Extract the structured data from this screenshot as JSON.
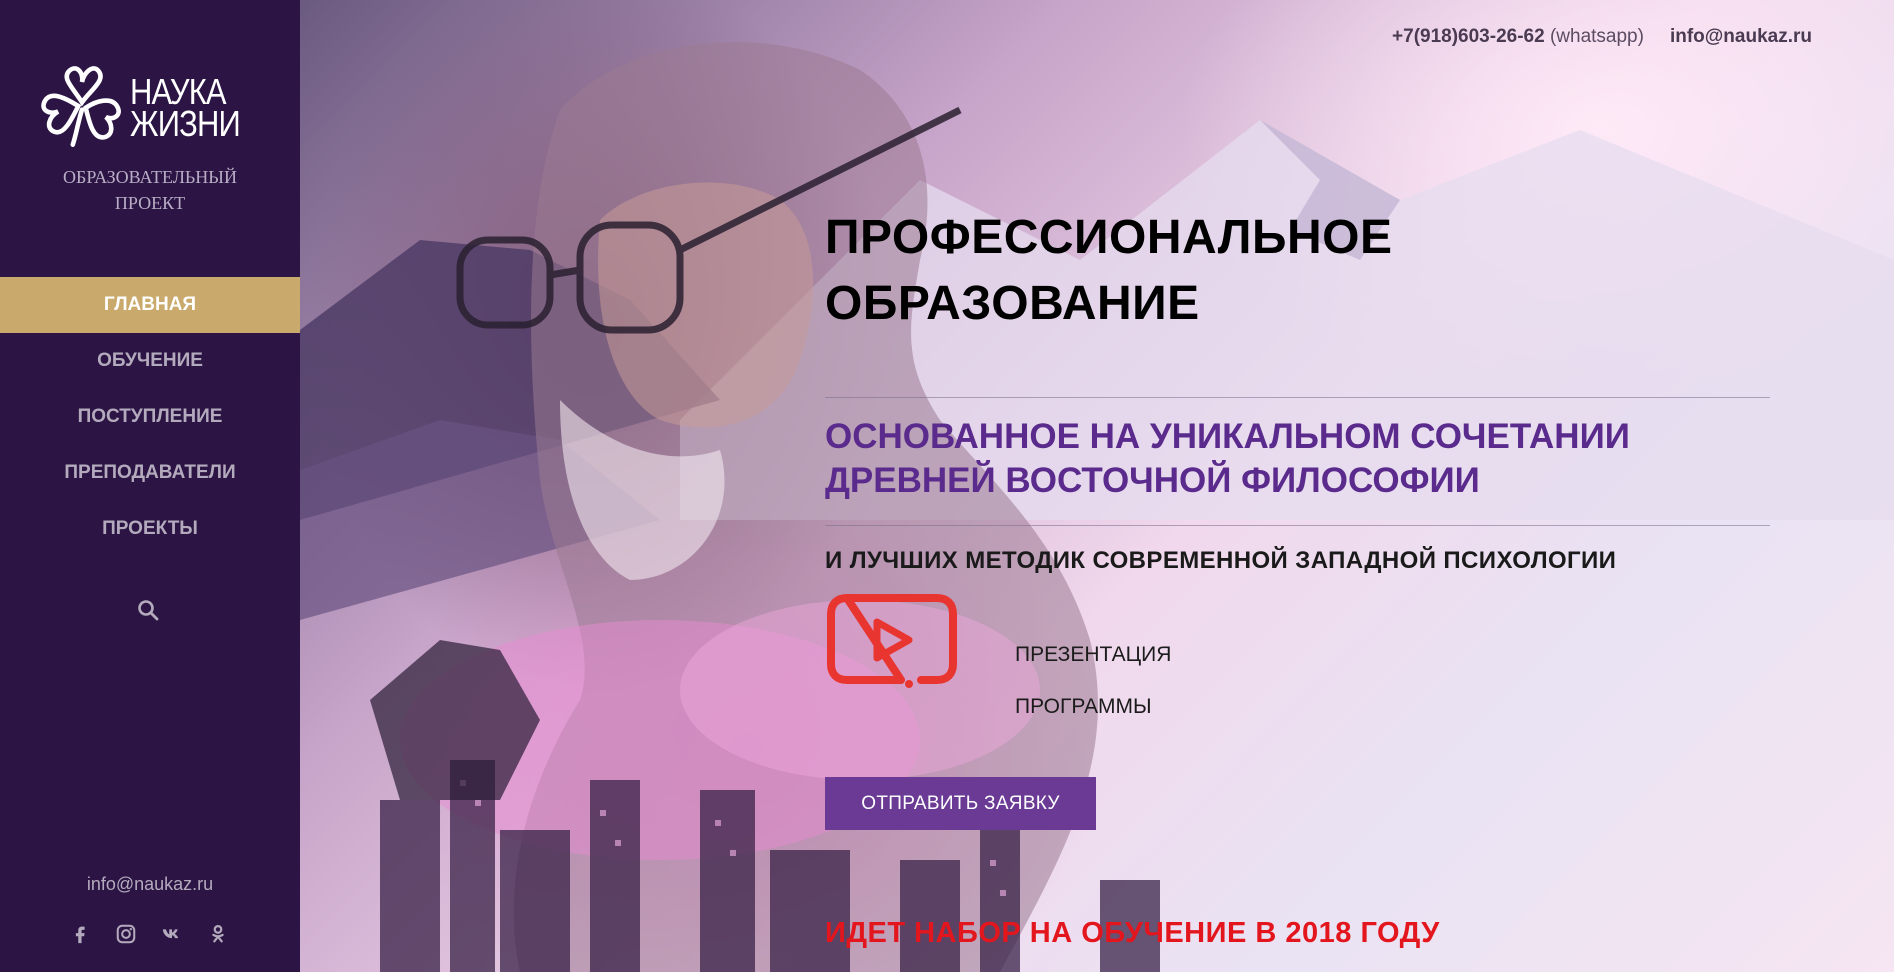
{
  "brand": {
    "logo_line1": "НАУКА",
    "logo_line2": "ЖИЗНИ",
    "subtitle": "ОБРАЗОВАТЕЛЬНЫЙ ПРОЕКТ"
  },
  "nav": {
    "items": [
      {
        "label": "ГЛАВНАЯ",
        "active": true
      },
      {
        "label": "ОБУЧЕНИЕ"
      },
      {
        "label": "ПОСТУПЛЕНИЕ"
      },
      {
        "label": "ПРЕПОДАВАТЕЛИ"
      },
      {
        "label": "ПРОЕКТЫ"
      }
    ],
    "search_icon": "search-icon"
  },
  "sidebar_footer": {
    "email": "info@naukaz.ru",
    "socials": [
      "facebook-icon",
      "instagram-icon",
      "vk-icon",
      "odnoklassniki-icon"
    ]
  },
  "header": {
    "phone": "+7(918)603-26-62",
    "phone_note": "(whatsapp)",
    "email": "info@naukaz.ru"
  },
  "hero": {
    "headline_line1": "ПРОФЕССИОНАЛЬНОЕ",
    "headline_line2": "ОБРАЗОВАНИЕ",
    "subhead_line1": "ОСНОВАННОЕ НА УНИКАЛЬНОМ СОЧЕТАНИИ",
    "subhead_line2": "ДРЕВНЕЙ ВОСТОЧНОЙ ФИЛОСОФИИ",
    "tagline": "И ЛУЧШИХ МЕТОДИК СОВРЕМЕННОЙ ЗАПАДНОЙ ПСИХОЛОГИИ",
    "video_label_line1": "ПРЕЗЕНТАЦИЯ",
    "video_label_line2": "ПРОГРАММЫ",
    "video_icon": "youtube-play-icon",
    "cta_label": "ОТПРАВИТЬ ЗАЯВКУ",
    "enroll_notice": "ИДЕТ НАБОР НА ОБУЧЕНИЕ В 2018 ГОДУ"
  },
  "colors": {
    "sidebar_bg": "#2c1544",
    "nav_active_bg": "#c9aa6c",
    "subhead": "#5a2a8c",
    "cta_bg": "#6a3a95",
    "notice": "#e3161d",
    "video_icon": "#e8352f"
  }
}
